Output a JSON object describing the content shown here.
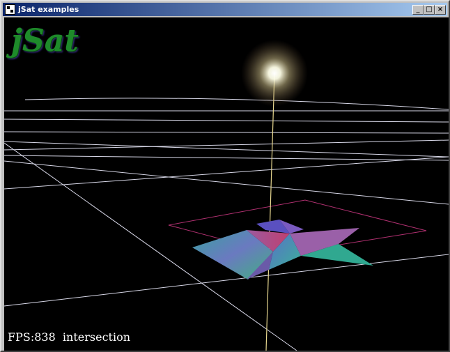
{
  "window": {
    "title": "jSat examples",
    "minimize_glyph": "_",
    "maximize_glyph": "□",
    "close_glyph": "×"
  },
  "viewport": {
    "logo_text": "jSat",
    "status_text": "FPS:838  intersection"
  },
  "colors": {
    "titlebar_start": "#0a246a",
    "titlebar_end": "#a6caf0",
    "background": "#000000",
    "grid": "#d8d8e8",
    "bounding_box": "#b03070",
    "light_beam": "#e8d890"
  }
}
